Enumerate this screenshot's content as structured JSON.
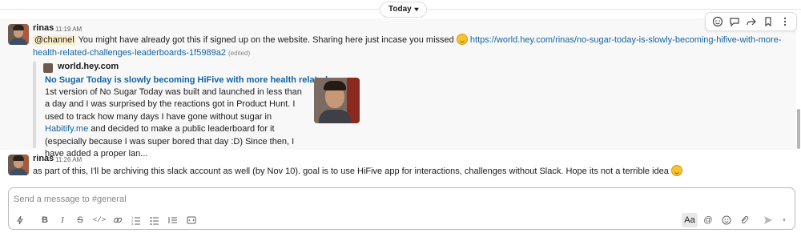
{
  "day_divider": {
    "label": "Today"
  },
  "toolbar": {
    "icons": [
      "add-reaction-icon",
      "reply-thread-icon",
      "share-icon",
      "bookmark-icon",
      "more-actions-icon"
    ]
  },
  "messages": [
    {
      "author": "rinas",
      "time": "11:19 AM",
      "mention": "@channel",
      "text": "You might have already got this if signed up on the website. Sharing here just incase you missed",
      "link": "https://world.hey.com/rinas/no-sugar-today-is-slowly-becoming-hifive-with-more-health-related-challenges-leaderboards-1f5989a2",
      "edited": "(edited)",
      "attachment": {
        "source": "world.hey.com",
        "title": "No Sugar Today is slowly becoming HiFive with more health related c...",
        "body_before_link": "1st version of No Sugar Today was built and launched in less than a day and I was surprised by the reactions got in Product Hunt. I used to track how many days I have gone without sugar in",
        "body_link": "Habitify.me",
        "body_after_link": "and decided to make a public leaderboard for it (especially because I was super bored that day :D) Since then, I have added a proper lan..."
      }
    },
    {
      "author": "rinas",
      "time": "11:26 AM",
      "text": "as part of this, I'll be archiving this slack account as well (by Nov 10). goal is to use HiFive app for interactions, challenges without Slack. Hope its not a terrible idea"
    }
  ],
  "composer": {
    "placeholder": "Send a message to #general",
    "aa_label": "Aa",
    "mention_label": "@"
  },
  "colors": {
    "link": "#1264a3",
    "mention_bg": "#fbeec6",
    "hover_bg": "#f8f8f8"
  }
}
